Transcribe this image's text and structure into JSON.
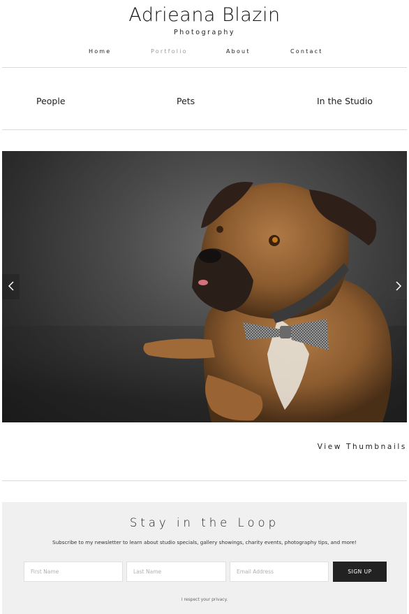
{
  "header": {
    "title": "Adrieana Blazin",
    "subtitle": "Photography"
  },
  "nav": {
    "items": [
      {
        "label": "Home",
        "active": false
      },
      {
        "label": "Portfolio",
        "active": true
      },
      {
        "label": "About",
        "active": false
      },
      {
        "label": "Contact",
        "active": false
      }
    ]
  },
  "categories": [
    "People",
    "Pets",
    "In the Studio"
  ],
  "slideshow": {
    "prev_icon": "chevron-left-icon",
    "next_icon": "chevron-right-icon",
    "view_thumbnails_label": "View Thumbnails"
  },
  "newsletter": {
    "title": "Stay in the Loop",
    "description": "Subscribe to my newsletter to learn about studio specials, gallery showings, charity events, photography tips, and more!",
    "first_name_placeholder": "First Name",
    "last_name_placeholder": "Last Name",
    "email_placeholder": "Email Address",
    "button_label": "SIGN UP",
    "privacy_note": "I respect your privacy."
  },
  "colors": {
    "background": "#ffffff",
    "nav_active": "#9a9a9a",
    "newsletter_bg": "#f0f0f0",
    "button_bg": "#222222"
  }
}
